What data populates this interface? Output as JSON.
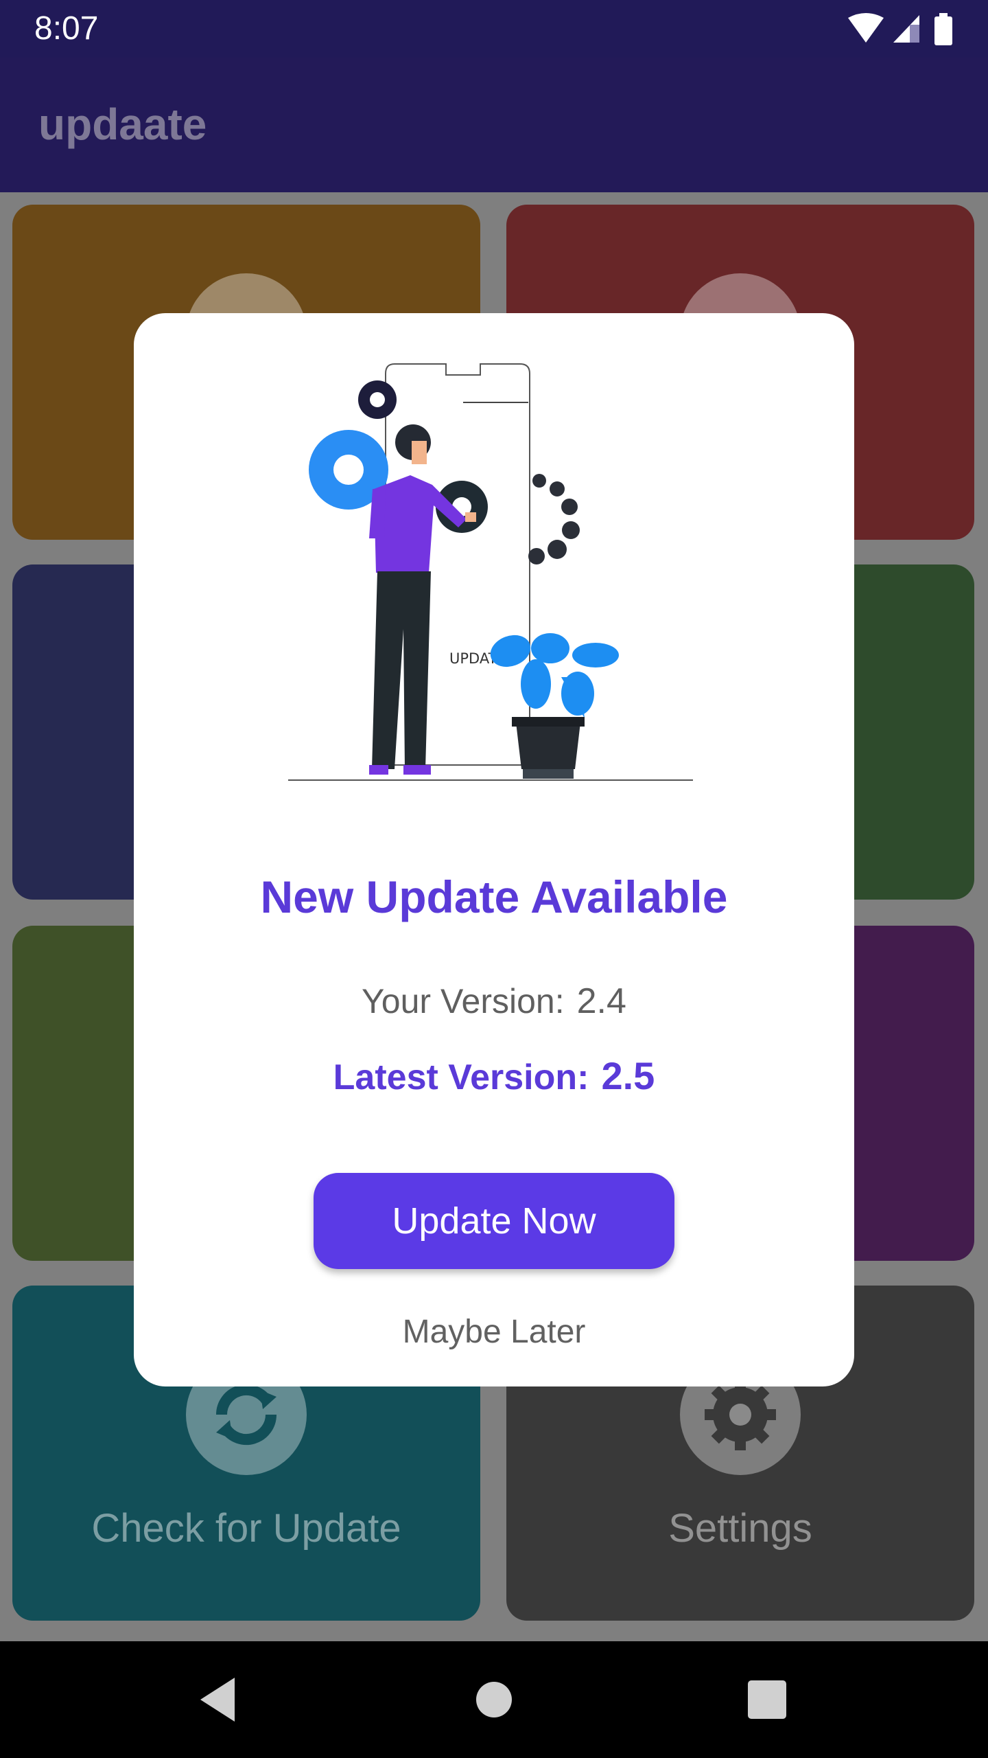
{
  "status_bar": {
    "time": "8:07"
  },
  "app_bar": {
    "title": "updaate"
  },
  "tiles": [
    {
      "color": "#6b4917",
      "icon": "location-icon",
      "label": ""
    },
    {
      "color": "#682628",
      "icon": "shield-icon",
      "label": ""
    },
    {
      "color": "#262951",
      "icon": "",
      "label": ""
    },
    {
      "color": "#2e4b2c",
      "icon": "",
      "label": ""
    },
    {
      "color": "#3f5128",
      "icon": "",
      "label": ""
    },
    {
      "color": "#431c4d",
      "icon": "",
      "label": ""
    },
    {
      "color": "#124f58",
      "icon": "refresh-icon",
      "label": "Check for Update"
    },
    {
      "color": "#393939",
      "icon": "gear-icon",
      "label": "Settings"
    }
  ],
  "dialog": {
    "illustration_text": "UPDATE",
    "heading": "New Update Available",
    "current_version_label": "Your Version:",
    "current_version_value": "2.4",
    "latest_version_label": "Latest Version:",
    "latest_version_value": "2.5",
    "primary_button": "Update Now",
    "secondary_button": "Maybe Later"
  },
  "colors": {
    "accent": "#5b3ae6",
    "heading": "#5a3ad8",
    "status_bar": "#211a58",
    "app_bar": "#231a58"
  },
  "nav_bar": {
    "icons": [
      "back-icon",
      "home-icon",
      "recents-icon"
    ]
  }
}
